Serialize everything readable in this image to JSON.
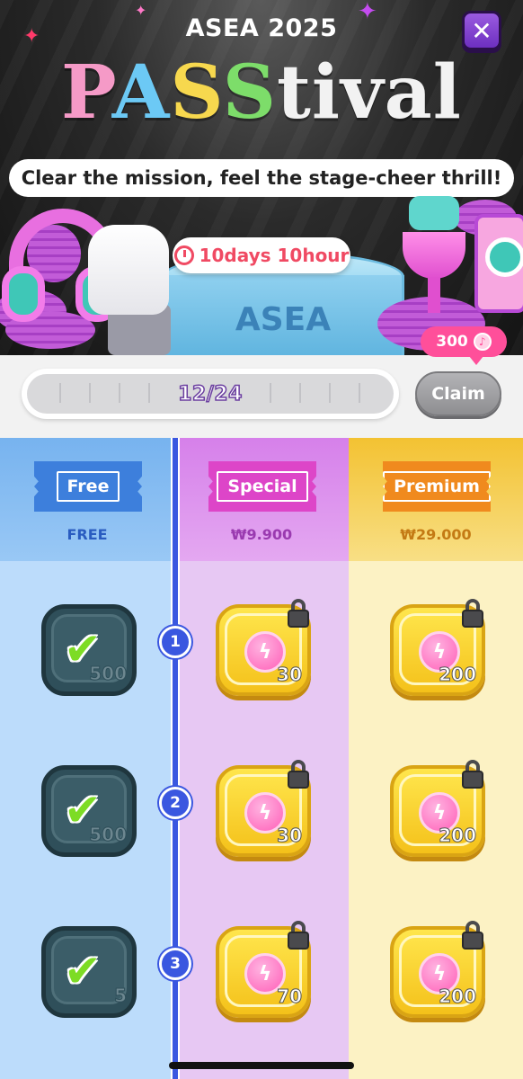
{
  "hero": {
    "subtitle": "ASEA 2025",
    "title_parts": [
      "P",
      "A",
      "S",
      "S",
      "tival"
    ],
    "tagline": "Clear the mission, feel the stage-cheer thrill!",
    "timer": "10days 10hour",
    "stage_label": "ASEA",
    "close_icon": "close-icon"
  },
  "progress": {
    "text": "12/24",
    "current": 12,
    "total": 24,
    "claim_label": "Claim",
    "bubble_value": "300"
  },
  "columns": [
    {
      "key": "free",
      "label": "Free",
      "price": "FREE",
      "color": "#3d7fdc"
    },
    {
      "key": "special",
      "label": "Special",
      "price": "₩9.900",
      "color": "#dd45c8"
    },
    {
      "key": "premium",
      "label": "Premium",
      "price": "₩29.000",
      "color": "#f08a1e"
    }
  ],
  "levels": [
    {
      "n": "1",
      "free": {
        "amount": "500",
        "claimed": true
      },
      "special": {
        "amount": "30",
        "locked": true
      },
      "premium": {
        "amount": "200",
        "locked": true
      }
    },
    {
      "n": "2",
      "free": {
        "amount": "500",
        "claimed": true
      },
      "special": {
        "amount": "30",
        "locked": true
      },
      "premium": {
        "amount": "200",
        "locked": true
      }
    },
    {
      "n": "3",
      "free": {
        "amount": "5",
        "claimed": true
      },
      "special": {
        "amount": "70",
        "locked": true
      },
      "premium": {
        "amount": "200",
        "locked": true
      }
    }
  ]
}
